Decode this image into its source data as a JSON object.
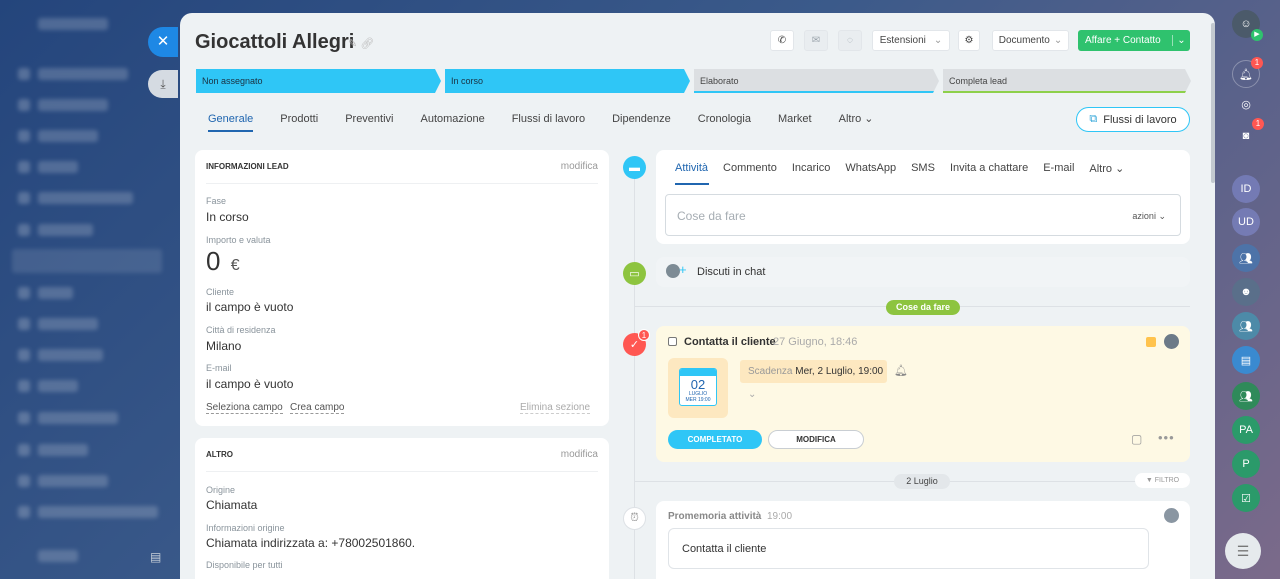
{
  "header": {
    "title": "Giocattoli Allegri",
    "extensions_label": "Estensioni",
    "document_label": "Documento",
    "primary_button_label": "Affare + Contatto"
  },
  "stages": [
    {
      "label": "Non assegnato",
      "active": true
    },
    {
      "label": "In corso",
      "active": true
    },
    {
      "label": "Elaborato",
      "active": false
    },
    {
      "label": "Completa lead",
      "active": false
    }
  ],
  "tabs": [
    "Generale",
    "Prodotti",
    "Preventivi",
    "Automazione",
    "Flussi di lavoro",
    "Dipendenze",
    "Cronologia",
    "Market",
    "Altro"
  ],
  "flows_button_label": "Flussi di lavoro",
  "lead_info": {
    "header": "INFORMAZIONI LEAD",
    "edit_label": "modifica",
    "fields": {
      "stage_label": "Fase",
      "stage_value": "In corso",
      "amount_label": "Importo e valuta",
      "amount_value": "0",
      "currency": "€",
      "client_label": "Cliente",
      "client_value": "il campo è vuoto",
      "city_label": "Città di residenza",
      "city_value": "Milano",
      "email_label": "E-mail",
      "email_value": "il campo è vuoto"
    },
    "select_field_label": "Seleziona campo",
    "create_field_label": "Crea campo",
    "delete_section_label": "Elimina sezione"
  },
  "other": {
    "header": "ALTRO",
    "edit_label": "modifica",
    "origin_label": "Origine",
    "origin_value": "Chiamata",
    "origin_info_label": "Informazioni origine",
    "origin_info_value": "Chiamata indirizzata a: +78002501860.",
    "available_label": "Disponibile per tutti"
  },
  "activity": {
    "tabs": [
      "Attività",
      "Commento",
      "Incarico",
      "WhatsApp",
      "SMS",
      "Invita a chattare",
      "E-mail",
      "Altro"
    ],
    "input_placeholder": "Cose da fare",
    "actions_label": "azioni",
    "chat_label": "Discuti in chat"
  },
  "todo_divider": "Cose da fare",
  "task": {
    "title": "Contatta il cliente",
    "created": "27 Giugno, 18:46",
    "calendar_day": "02",
    "calendar_month": "LUGLIO",
    "calendar_weekday": "MER 19:00",
    "deadline_label": "Scadenza",
    "deadline_value": "Mer, 2 Luglio, 19:00",
    "completed_button": "COMPLETATO",
    "edit_button": "MODIFICA",
    "badge": "1"
  },
  "date_divider": "2 Luglio",
  "filter_label": "FILTRO",
  "reminder": {
    "title": "Promemoria attività",
    "time": "19:00",
    "text": "Contatta il cliente"
  },
  "rightbar_badges": {
    "bell": "1",
    "chat": "1"
  },
  "rightbar_labels": {
    "pa": "PA",
    "p": "P"
  },
  "colors": {
    "accent": "#2fc6f6",
    "green": "#2fc26e",
    "link": "#2066b0",
    "task_bg": "#fef9e4"
  }
}
